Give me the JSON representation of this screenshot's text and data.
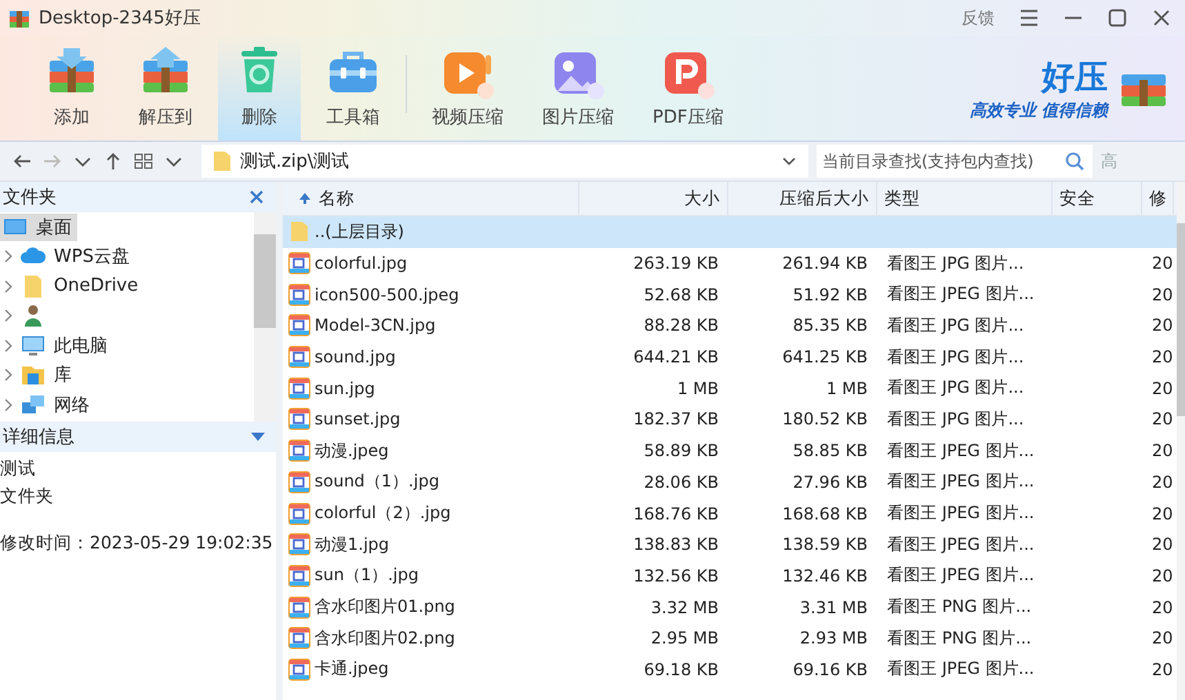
{
  "window": {
    "title": "Desktop-2345好压",
    "feedback": "反馈"
  },
  "toolbar": [
    {
      "label": "添加",
      "kind": "add",
      "selected": false
    },
    {
      "label": "解压到",
      "kind": "extract",
      "selected": false
    },
    {
      "label": "删除",
      "kind": "delete",
      "selected": true
    },
    {
      "label": "工具箱",
      "kind": "toolbox",
      "selected": false
    },
    {
      "label": "视频压缩",
      "kind": "video",
      "selected": false
    },
    {
      "label": "图片压缩",
      "kind": "image",
      "selected": false
    },
    {
      "label": "PDF压缩",
      "kind": "pdf",
      "selected": false
    }
  ],
  "brand": {
    "name": "好压",
    "slogan": "高效专业 值得信赖"
  },
  "address_bar": {
    "path": "测试.zip\\测试",
    "search_placeholder": "当前目录查找(支持包内查找)",
    "advanced": "高"
  },
  "sidebar": {
    "title": "文件夹",
    "items": [
      {
        "label": "桌面",
        "kind": "desktop",
        "selected": true
      },
      {
        "label": "WPS云盘",
        "kind": "cloud",
        "selected": false
      },
      {
        "label": "OneDrive",
        "kind": "folder",
        "selected": false
      },
      {
        "kind": "user",
        "selected": false
      },
      {
        "label": "此电脑",
        "kind": "computer",
        "selected": false
      },
      {
        "label": "库",
        "kind": "library",
        "selected": false
      },
      {
        "label": "网络",
        "kind": "network",
        "selected": false
      }
    ]
  },
  "details": {
    "title": "详细信息",
    "name": "测试",
    "type": "文件夹",
    "modified": "修改时间：2023-05-29 19:02:35"
  },
  "table": {
    "columns": [
      "名称",
      "大小",
      "压缩后大小",
      "类型",
      "安全",
      "修"
    ],
    "rows": [
      {
        "kind": "parent",
        "name": "..(上层目录)",
        "size": "",
        "packed": "",
        "type": "",
        "modified": "",
        "selected": true
      },
      {
        "kind": "image",
        "name": "colorful.jpg",
        "size": "263.19 KB",
        "packed": "261.94 KB",
        "type": "看图王 JPG 图片...",
        "modified": "20",
        "selected": false
      },
      {
        "kind": "image",
        "name": "icon500-500.jpeg",
        "size": "52.68 KB",
        "packed": "51.92 KB",
        "type": "看图王 JPEG 图片...",
        "modified": "20",
        "selected": false
      },
      {
        "kind": "image",
        "name": "Model-3CN.jpg",
        "size": "88.28 KB",
        "packed": "85.35 KB",
        "type": "看图王 JPG 图片...",
        "modified": "20",
        "selected": false
      },
      {
        "kind": "image",
        "name": "sound.jpg",
        "size": "644.21 KB",
        "packed": "641.25 KB",
        "type": "看图王 JPG 图片...",
        "modified": "20",
        "selected": false
      },
      {
        "kind": "image",
        "name": "sun.jpg",
        "size": "1 MB",
        "packed": "1 MB",
        "type": "看图王 JPG 图片...",
        "modified": "20",
        "selected": false
      },
      {
        "kind": "image",
        "name": "sunset.jpg",
        "size": "182.37 KB",
        "packed": "180.52 KB",
        "type": "看图王 JPG 图片...",
        "modified": "20",
        "selected": false
      },
      {
        "kind": "image",
        "name": "动漫.jpeg",
        "size": "58.89 KB",
        "packed": "58.85 KB",
        "type": "看图王 JPEG 图片...",
        "modified": "20",
        "selected": false
      },
      {
        "kind": "image",
        "name": "sound（1）.jpg",
        "size": "28.06 KB",
        "packed": "27.96 KB",
        "type": "看图王 JPEG 图片...",
        "modified": "20",
        "selected": false
      },
      {
        "kind": "image",
        "name": "colorful（2）.jpg",
        "size": "168.76 KB",
        "packed": "168.68 KB",
        "type": "看图王 JPEG 图片...",
        "modified": "20",
        "selected": false
      },
      {
        "kind": "image",
        "name": "动漫1.jpg",
        "size": "138.83 KB",
        "packed": "138.59 KB",
        "type": "看图王 JPEG 图片...",
        "modified": "20",
        "selected": false
      },
      {
        "kind": "image",
        "name": "sun（1）.jpg",
        "size": "132.56 KB",
        "packed": "132.46 KB",
        "type": "看图王 JPEG 图片...",
        "modified": "20",
        "selected": false
      },
      {
        "kind": "image",
        "name": "含水印图片01.png",
        "size": "3.32 MB",
        "packed": "3.31 MB",
        "type": "看图王 PNG 图片...",
        "modified": "20",
        "selected": false
      },
      {
        "kind": "image",
        "name": "含水印图片02.png",
        "size": "2.95 MB",
        "packed": "2.93 MB",
        "type": "看图王 PNG 图片...",
        "modified": "20",
        "selected": false
      },
      {
        "kind": "image",
        "name": "卡通.jpeg",
        "size": "69.18 KB",
        "packed": "69.16 KB",
        "type": "看图王 JPEG 图片...",
        "modified": "20",
        "selected": false
      }
    ]
  }
}
